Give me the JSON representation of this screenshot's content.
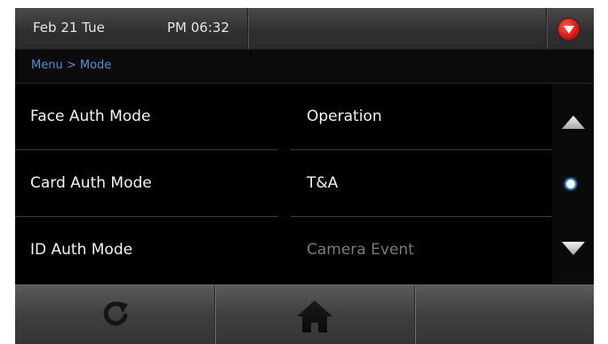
{
  "status_bar": {
    "date": "Feb 21 Tue",
    "time": "PM 06:32",
    "alert_icon": "red-down-arrow-icon"
  },
  "breadcrumb": "Menu > Mode",
  "rows": [
    {
      "label": "Face Auth Mode",
      "value": "Operation",
      "value_dimmed": false
    },
    {
      "label": "Card Auth Mode",
      "value": "T&A",
      "value_dimmed": false
    },
    {
      "label": "ID Auth Mode",
      "value": "Camera Event",
      "value_dimmed": true
    }
  ],
  "scroll": {
    "up_icon": "triangle-up-icon",
    "indicator_icon": "page-dot-icon",
    "down_icon": "triangle-down-icon"
  },
  "bottom_bar": {
    "refresh_icon": "refresh-icon",
    "home_icon": "home-icon"
  },
  "colors": {
    "breadcrumb": "#4d8fd6",
    "alert": "#d10f0f",
    "dimmed_text": "#7a7a7a"
  }
}
